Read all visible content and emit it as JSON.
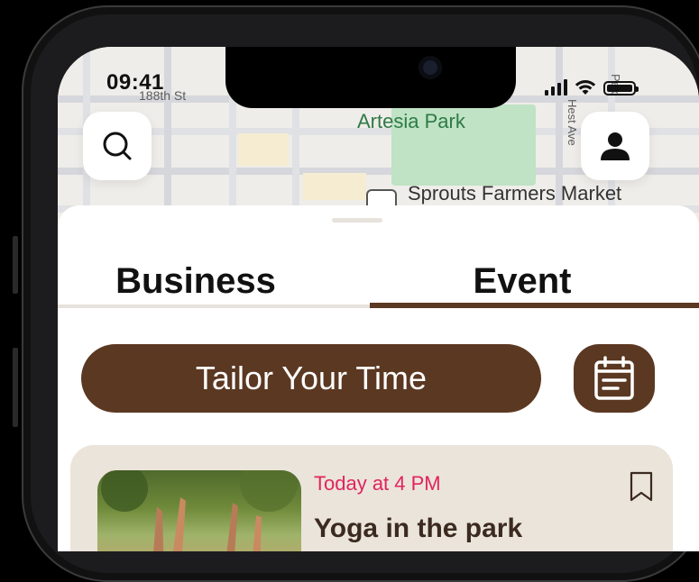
{
  "status_bar": {
    "time": "09:41"
  },
  "map": {
    "labels": {
      "street_188th": "188th St",
      "park": "Artesia Park",
      "market": "Sprouts Farmers Market",
      "vert_ave": "Hest Ave",
      "vert_ave2": "Pex"
    }
  },
  "tabs": [
    {
      "label": "Business",
      "active": false
    },
    {
      "label": "Event",
      "active": true
    }
  ],
  "actions": {
    "tailor_label": "Tailor Your Time"
  },
  "event": {
    "time": "Today at 4 PM",
    "title": "Yoga in the park"
  },
  "colors": {
    "brand_brown": "#5b3822",
    "time_pink": "#e0245e",
    "card_bg": "#ebe4da",
    "park_green": "#bfe3c4"
  },
  "icons": {
    "search": "search-icon",
    "profile": "user-icon",
    "calendar": "calendar-icon",
    "bookmark": "bookmark-icon"
  }
}
